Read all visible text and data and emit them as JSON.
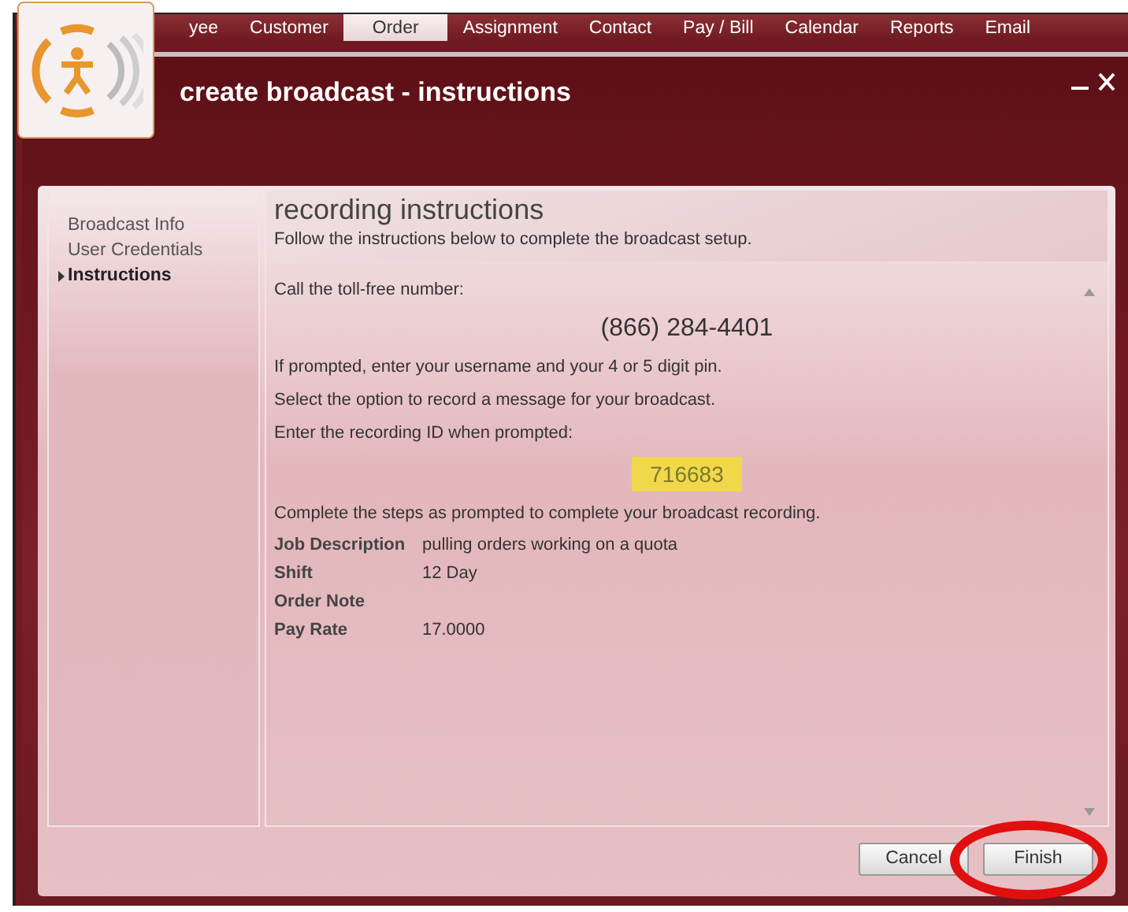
{
  "nav_tabs": [
    {
      "label": "yee",
      "selected": false
    },
    {
      "label": "Customer",
      "selected": false
    },
    {
      "label": "Order",
      "selected": true
    },
    {
      "label": "Assignment",
      "selected": false
    },
    {
      "label": "Contact",
      "selected": false
    },
    {
      "label": "Pay / Bill",
      "selected": false
    },
    {
      "label": "Calendar",
      "selected": false
    },
    {
      "label": "Reports",
      "selected": false
    },
    {
      "label": "Email",
      "selected": false
    }
  ],
  "dialog": {
    "title": "create broadcast - instructions"
  },
  "steps": [
    {
      "label": "Broadcast Info",
      "selected": false
    },
    {
      "label": "User Credentials",
      "selected": false
    },
    {
      "label": "Instructions",
      "selected": true
    }
  ],
  "section": {
    "heading": "recording instructions",
    "subtitle": "Follow the instructions below to complete the broadcast setup."
  },
  "lines": [
    {
      "kind": "text",
      "text": "Call the toll-free number:"
    },
    {
      "kind": "phone",
      "text": "(866) 284-4401"
    },
    {
      "kind": "text",
      "text": "If prompted, enter your username and your 4 or 5 digit pin."
    },
    {
      "kind": "text",
      "text": "Select the option to record a message for your broadcast."
    },
    {
      "kind": "text",
      "text": "Enter the recording ID when prompted:"
    },
    {
      "kind": "code",
      "text": "716683"
    },
    {
      "kind": "text",
      "text": "Complete the steps as prompted to complete your broadcast recording."
    }
  ],
  "details": [
    {
      "label": "Job Description",
      "value": "pulling orders working on a quota"
    },
    {
      "label": "Shift",
      "value": "12 Day"
    },
    {
      "label": "Order Note"
    },
    {
      "label": "Pay Rate",
      "value": "17.0000"
    }
  ],
  "buttons": [
    {
      "label": "Cancel",
      "highlighted": false
    },
    {
      "label": "Finish",
      "highlighted": true
    }
  ]
}
